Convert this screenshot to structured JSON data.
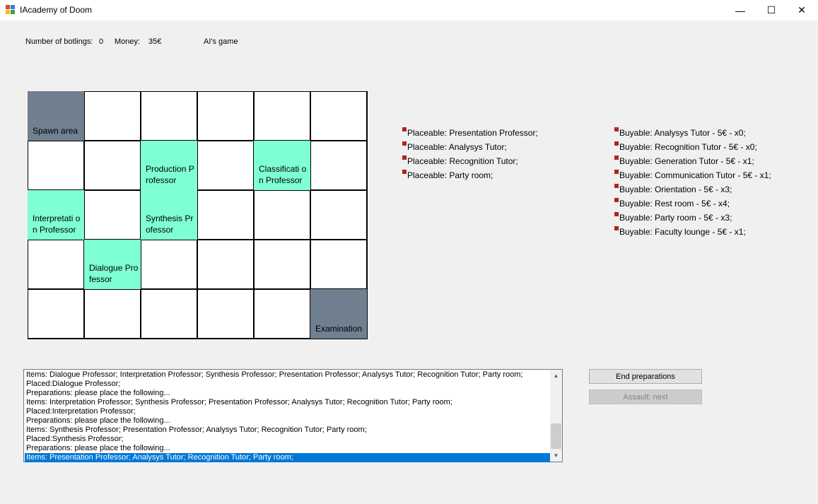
{
  "window": {
    "title": "IAcademy of Doom",
    "controls": {
      "minimize": "—",
      "maximize": "☐",
      "close": "✕"
    }
  },
  "info": {
    "botlings_label": "Number of botlings:",
    "botlings_value": "0",
    "money_label": "Money:",
    "money_value": "35€",
    "game_label": "AI's game"
  },
  "board": {
    "cells": [
      {
        "label": "Spawn area",
        "type": "gray"
      },
      {
        "label": "",
        "type": "empty"
      },
      {
        "label": "",
        "type": "empty"
      },
      {
        "label": "",
        "type": "empty"
      },
      {
        "label": "",
        "type": "empty"
      },
      {
        "label": "",
        "type": "empty"
      },
      {
        "label": "",
        "type": "empty"
      },
      {
        "label": "",
        "type": "empty"
      },
      {
        "label": "Production P rofessor",
        "type": "green"
      },
      {
        "label": "",
        "type": "empty"
      },
      {
        "label": "Classificati on Professor",
        "type": "green"
      },
      {
        "label": "",
        "type": "empty"
      },
      {
        "label": "Interpretati on Professor",
        "type": "green"
      },
      {
        "label": "",
        "type": "empty"
      },
      {
        "label": "Synthesis Pr ofessor",
        "type": "green"
      },
      {
        "label": "",
        "type": "empty"
      },
      {
        "label": "",
        "type": "empty"
      },
      {
        "label": "",
        "type": "empty"
      },
      {
        "label": "",
        "type": "empty"
      },
      {
        "label": "Dialogue Pro fessor",
        "type": "green"
      },
      {
        "label": "",
        "type": "empty"
      },
      {
        "label": "",
        "type": "empty"
      },
      {
        "label": "",
        "type": "empty"
      },
      {
        "label": "",
        "type": "empty"
      },
      {
        "label": "",
        "type": "empty"
      },
      {
        "label": "",
        "type": "empty"
      },
      {
        "label": "",
        "type": "empty"
      },
      {
        "label": "",
        "type": "empty"
      },
      {
        "label": "",
        "type": "empty"
      },
      {
        "label": "Examination",
        "type": "gray"
      }
    ]
  },
  "placeable": [
    "Placeable: Presentation Professor;",
    "Placeable: Analysys Tutor;",
    "Placeable: Recognition Tutor;",
    "Placeable: Party room;"
  ],
  "buyable": [
    "Buyable: Analysys Tutor - 5€ - x0;",
    "Buyable: Recognition Tutor - 5€ - x0;",
    "Buyable: Generation Tutor - 5€ - x1;",
    "Buyable: Communication Tutor - 5€ - x1;",
    "Buyable: Orientation - 5€ - x3;",
    "Buyable: Rest room - 5€ - x4;",
    "Buyable: Party room - 5€ - x3;",
    "Buyable: Faculty lounge - 5€ - x1;"
  ],
  "log": {
    "lines": [
      "Items: Dialogue Professor;  Interpretation Professor;  Synthesis Professor;  Presentation Professor;  Analysys Tutor;  Recognition Tutor;  Party room;",
      "Placed:Dialogue Professor;",
      "Preparations: please place the following...",
      "Items: Interpretation Professor;  Synthesis Professor;  Presentation Professor;  Analysys Tutor;  Recognition Tutor;  Party room;",
      "Placed:Interpretation Professor;",
      "Preparations: please place the following...",
      "Items: Synthesis Professor;  Presentation Professor;  Analysys Tutor;  Recognition Tutor;  Party room;",
      "Placed:Synthesis Professor;",
      "Preparations: please place the following...",
      "Items: Presentation Professor;  Analysys Tutor;  Recognition Tutor;  Party room;"
    ],
    "selected_index": 9
  },
  "buttons": {
    "end_preparations": "End preparations",
    "assault_next": "Assault: next"
  },
  "colors": {
    "placed_cell": "#7fffd4",
    "fixed_cell": "#708090",
    "bullet": "#b22222",
    "selection": "#0078d7"
  }
}
